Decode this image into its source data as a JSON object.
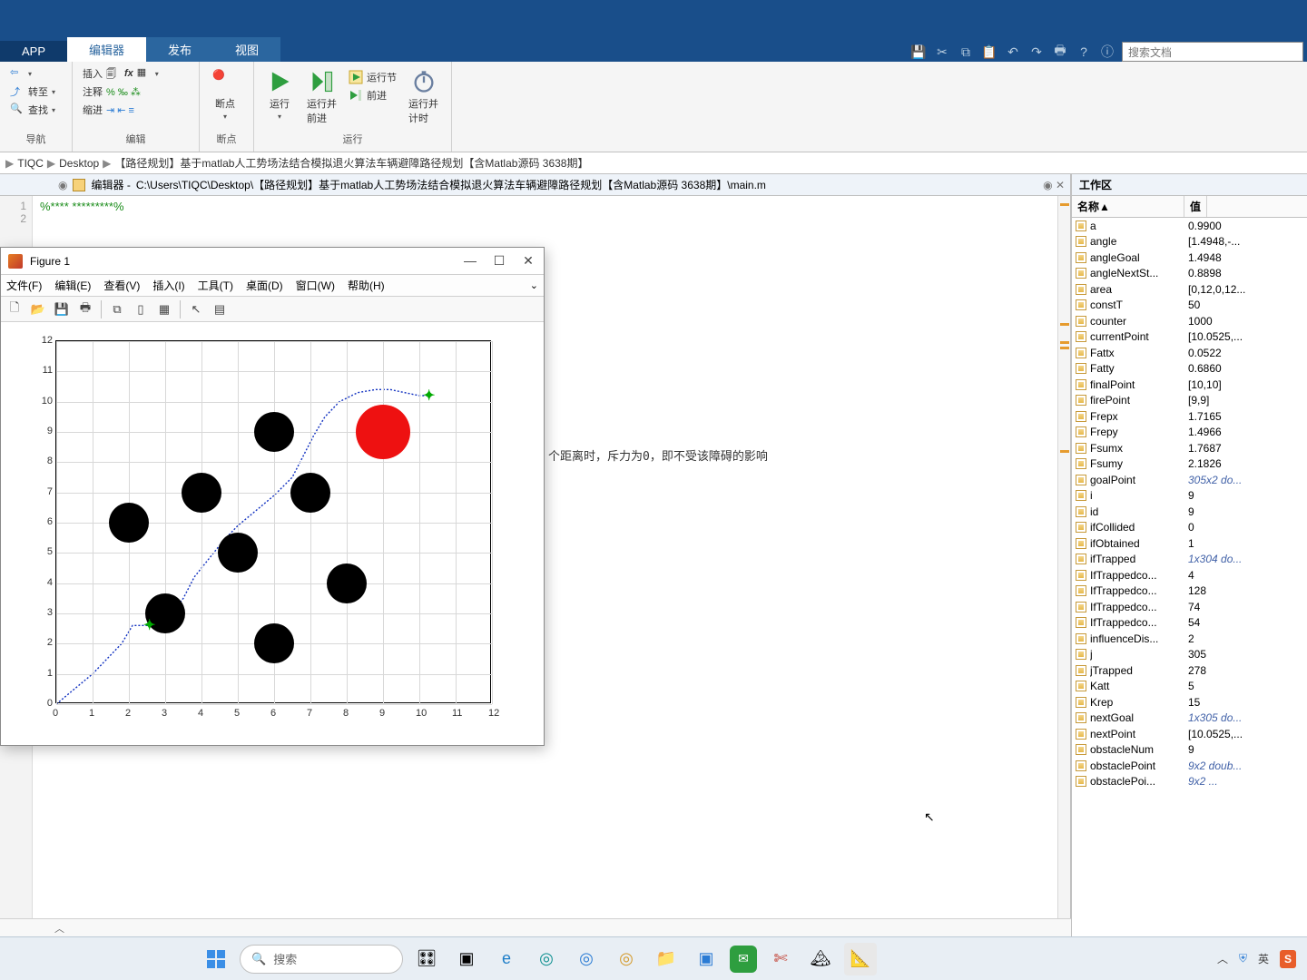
{
  "tabs": {
    "app": "APP",
    "editor": "编辑器",
    "publish": "发布",
    "view": "视图"
  },
  "quick": {
    "search_placeholder": "搜索文档"
  },
  "ribbon": {
    "nav": {
      "label": "导航",
      "insert": "插入",
      "comment": "注释",
      "indent": "缩进",
      "goto": "转至",
      "find": "查找"
    },
    "edit": {
      "label": "编辑"
    },
    "break": {
      "label": "断点",
      "btn": "断点"
    },
    "run": {
      "label": "运行",
      "run": "运行",
      "step": "运行并\n前进",
      "section": "运行节",
      "advance": "前进",
      "time": "运行并\n计时"
    }
  },
  "breadcrumb": {
    "a": "TIQC",
    "b": "Desktop",
    "c": "【路径规划】基于matlab人工势场法结合模拟退火算法车辆避障路径规划【含Matlab源码 3638期】"
  },
  "editor": {
    "title_prefix": "编辑器 - ",
    "path": "C:\\Users\\TIQC\\Desktop\\【路径规划】基于matlab人工势场法结合模拟退火算法车辆避障路径规划【含Matlab源码 3638期】\\main.m",
    "line1": "%**** *********%",
    "visible_fragment": "个距离时，斥力为0，即不受该障碍的影响"
  },
  "figure": {
    "title": "Figure 1",
    "menu": {
      "file": "文件(F)",
      "edit": "编辑(E)",
      "view": "查看(V)",
      "insert": "插入(I)",
      "tool": "工具(T)",
      "desktop": "桌面(D)",
      "window": "窗口(W)",
      "help": "帮助(H)"
    }
  },
  "chart_data": {
    "type": "scatter",
    "xlim": [
      0,
      12
    ],
    "ylim": [
      0,
      12
    ],
    "xticks": [
      0,
      1,
      2,
      3,
      4,
      5,
      6,
      7,
      8,
      9,
      10,
      11,
      12
    ],
    "yticks": [
      0,
      1,
      2,
      3,
      4,
      5,
      6,
      7,
      8,
      9,
      10,
      11,
      12
    ],
    "obstacles": [
      [
        2,
        6
      ],
      [
        3,
        3
      ],
      [
        4,
        7
      ],
      [
        5,
        5
      ],
      [
        6,
        9
      ],
      [
        6,
        2
      ],
      [
        7,
        7
      ],
      [
        8,
        4
      ]
    ],
    "obstacle_radius": 0.55,
    "fire": {
      "center": [
        9,
        9
      ],
      "radius": 0.75
    },
    "start": [
      0,
      0
    ],
    "goal_markers": [
      [
        2.6,
        2.6
      ],
      [
        10.3,
        10.2
      ]
    ],
    "path": [
      [
        0,
        0
      ],
      [
        0.5,
        0.5
      ],
      [
        1.0,
        1.0
      ],
      [
        1.4,
        1.5
      ],
      [
        1.8,
        2.0
      ],
      [
        2.1,
        2.6
      ],
      [
        2.6,
        2.6
      ],
      [
        3.1,
        2.9
      ],
      [
        3.5,
        3.5
      ],
      [
        3.8,
        4.2
      ],
      [
        4.2,
        4.8
      ],
      [
        4.6,
        5.4
      ],
      [
        5.0,
        5.9
      ],
      [
        5.5,
        6.4
      ],
      [
        6.0,
        6.9
      ],
      [
        6.5,
        7.5
      ],
      [
        6.8,
        8.2
      ],
      [
        7.1,
        8.9
      ],
      [
        7.4,
        9.5
      ],
      [
        7.8,
        10.0
      ],
      [
        8.3,
        10.3
      ],
      [
        8.8,
        10.4
      ],
      [
        9.2,
        10.4
      ],
      [
        9.6,
        10.3
      ],
      [
        10.0,
        10.2
      ],
      [
        10.3,
        10.2
      ]
    ]
  },
  "workspace": {
    "title": "工作区",
    "head_name": "名称▲",
    "head_value": "值",
    "rows": [
      {
        "n": "a",
        "v": "0.9900"
      },
      {
        "n": "angle",
        "v": "[1.4948,-..."
      },
      {
        "n": "angleGoal",
        "v": "1.4948"
      },
      {
        "n": "angleNextSt...",
        "v": "0.8898"
      },
      {
        "n": "area",
        "v": "[0,12,0,12..."
      },
      {
        "n": "constT",
        "v": "50"
      },
      {
        "n": "counter",
        "v": "1000"
      },
      {
        "n": "currentPoint",
        "v": "[10.0525,..."
      },
      {
        "n": "Fattx",
        "v": "0.0522"
      },
      {
        "n": "Fatty",
        "v": "0.6860"
      },
      {
        "n": "finalPoint",
        "v": "[10,10]"
      },
      {
        "n": "firePoint",
        "v": "[9,9]"
      },
      {
        "n": "Frepx",
        "v": "1.7165"
      },
      {
        "n": "Frepy",
        "v": "1.4966"
      },
      {
        "n": "Fsumx",
        "v": "1.7687"
      },
      {
        "n": "Fsumy",
        "v": "2.1826"
      },
      {
        "n": "goalPoint",
        "v": "305x2 do...",
        "i": true
      },
      {
        "n": "i",
        "v": "9"
      },
      {
        "n": "id",
        "v": "9"
      },
      {
        "n": "ifCollided",
        "v": "0"
      },
      {
        "n": "ifObtained",
        "v": "1"
      },
      {
        "n": "ifTrapped",
        "v": "1x304 do...",
        "i": true
      },
      {
        "n": "IfTrappedco...",
        "v": "4"
      },
      {
        "n": "IfTrappedco...",
        "v": "128"
      },
      {
        "n": "IfTrappedco...",
        "v": "74"
      },
      {
        "n": "IfTrappedco...",
        "v": "54"
      },
      {
        "n": "influenceDis...",
        "v": "2"
      },
      {
        "n": "j",
        "v": "305"
      },
      {
        "n": "jTrapped",
        "v": "278"
      },
      {
        "n": "Katt",
        "v": "5"
      },
      {
        "n": "Krep",
        "v": "15"
      },
      {
        "n": "nextGoal",
        "v": "1x305 do...",
        "i": true
      },
      {
        "n": "nextPoint",
        "v": "[10.0525,..."
      },
      {
        "n": "obstacleNum",
        "v": "9"
      },
      {
        "n": "obstaclePoint",
        "v": "9x2 doub...",
        "i": true
      },
      {
        "n": "obstaclePoi...",
        "v": "9x2 ...",
        "i": true
      }
    ]
  },
  "taskbar": {
    "search": "搜索",
    "ime": "英"
  }
}
